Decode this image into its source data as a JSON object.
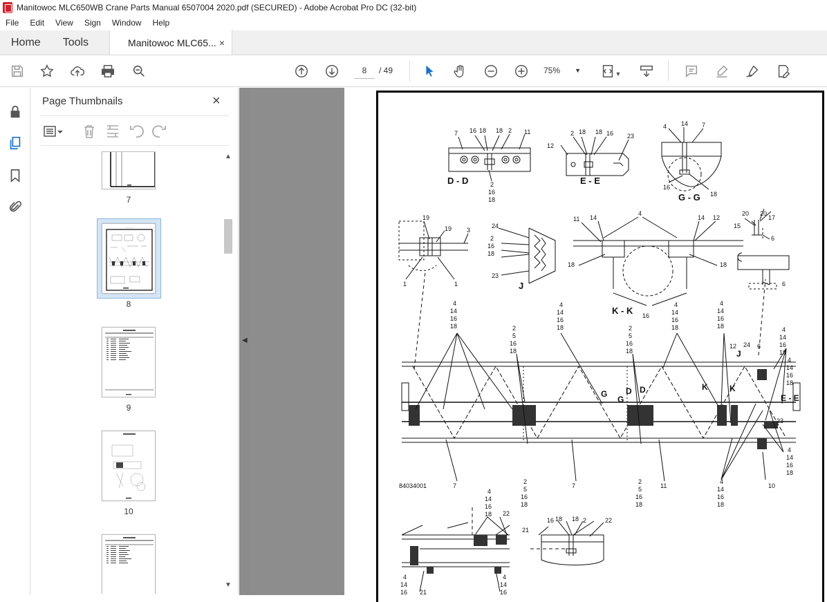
{
  "window": {
    "title": "Manitowoc MLC650WB Crane Parts Manual 6507004 2020.pdf (SECURED) - Adobe Acrobat Pro DC (32-bit)"
  },
  "menu": [
    "File",
    "Edit",
    "View",
    "Sign",
    "Window",
    "Help"
  ],
  "tabs": {
    "home": "Home",
    "tools": "Tools",
    "document": "Manitowoc MLC65...",
    "close": "×"
  },
  "toolbar": {
    "current_page": "8",
    "total_pages": "/ 49",
    "zoom": "75%"
  },
  "panel": {
    "title": "Page Thumbnails",
    "close": "×"
  },
  "thumbnails": [
    {
      "label": "7",
      "selected": false
    },
    {
      "label": "8",
      "selected": true
    },
    {
      "label": "9",
      "selected": false
    },
    {
      "label": "10",
      "selected": false
    },
    {
      "label": "",
      "selected": false
    }
  ],
  "drawing": {
    "sections": {
      "dd": "D - D",
      "ee": "E - E",
      "gg": "G - G",
      "j": "J",
      "kk": "K - K"
    },
    "callouts_dd_top": [
      "7",
      "16",
      "18",
      "18",
      "2",
      "11"
    ],
    "callouts_dd_bottom": [
      "2",
      "16",
      "18"
    ],
    "callouts_ee": [
      "2",
      "18",
      "18",
      "16",
      "23",
      "12"
    ],
    "callouts_gg": [
      "4",
      "14",
      "7",
      "16",
      "18"
    ],
    "callouts_misc1": [
      "19",
      "19",
      "3",
      "1",
      "1"
    ],
    "callouts_j": [
      "24",
      "2",
      "16",
      "18",
      "23"
    ],
    "callouts_kk": [
      "4",
      "11",
      "14",
      "14",
      "12",
      "18",
      "18",
      "16"
    ],
    "callouts_right": [
      "20",
      "20",
      "17",
      "15",
      "6",
      "6"
    ],
    "stack_4_14_16_18": [
      "4",
      "14",
      "16",
      "18"
    ],
    "stack_2_5_16_18": [
      "2",
      "5",
      "16",
      "18"
    ],
    "main_labels": [
      "12",
      "24",
      "J",
      "6",
      "K",
      "K",
      "G",
      "G",
      "D",
      "D",
      "E - E",
      "23"
    ],
    "bottom_row": [
      "84034001",
      "7",
      "7",
      "11",
      "10"
    ],
    "lower_callouts": [
      "21",
      "22",
      "16",
      "18",
      "18",
      "2",
      "22",
      "21"
    ],
    "lower_stack": [
      "4",
      "14",
      "16",
      "18"
    ]
  }
}
